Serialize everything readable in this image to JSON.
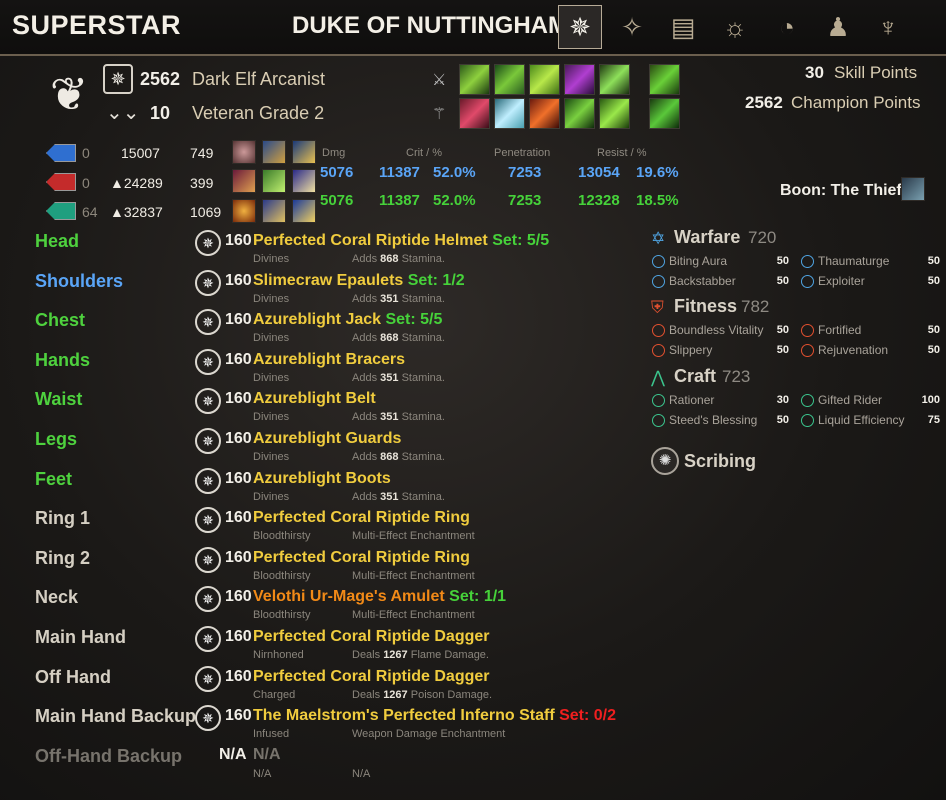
{
  "brand": "SUPERSTAR",
  "title": "DUKE OF NUTTINGHAM",
  "header": {
    "champion_level": "2562",
    "race_class": "Dark Elf Arcanist",
    "level": "10",
    "rank": "Veteran Grade 2",
    "skill_points": "30",
    "skill_points_label": "Skill Points",
    "champion_points": "2562",
    "champion_points_label": "Champion Points"
  },
  "resources": [
    {
      "color": "#2f6fd0",
      "regen": "0",
      "max": "15007",
      "recovery": "749"
    },
    {
      "color": "#c42b2b",
      "regen": "0",
      "max": "▲24289",
      "recovery": "399"
    },
    {
      "color": "#1f9f7f",
      "regen": "64",
      "max": "▲32837",
      "recovery": "1069"
    }
  ],
  "stat_headers": {
    "dmg": "Dmg",
    "crit": "Crit / %",
    "pen": "Penetration",
    "resist": "Resist / %"
  },
  "stats_blue": {
    "dmg": "5076",
    "crit": "11387",
    "crit_pct": "52.0%",
    "pen": "7253",
    "resist": "13054",
    "resist_pct": "19.6%"
  },
  "stats_green": {
    "dmg": "5076",
    "crit": "11387",
    "crit_pct": "52.0%",
    "pen": "7253",
    "resist": "12328",
    "resist_pct": "18.5%"
  },
  "boon": "Boon: The Thief",
  "gear": [
    {
      "slot": "Head",
      "slot_color": "green",
      "cp": "160",
      "name": "Perfected Coral Riptide Helmet",
      "set": "Set: 5/5",
      "set_color": "green",
      "trait": "Divines",
      "ench_pre": "Adds",
      "ench_val": "868",
      "ench_post": "Stamina."
    },
    {
      "slot": "Shoulders",
      "slot_color": "blue",
      "cp": "160",
      "name": "Slimecraw Epaulets",
      "set": "Set: 1/2",
      "set_color": "green",
      "trait": "Divines",
      "ench_pre": "Adds",
      "ench_val": "351",
      "ench_post": "Stamina."
    },
    {
      "slot": "Chest",
      "slot_color": "green",
      "cp": "160",
      "name": "Azureblight Jack",
      "set": "Set: 5/5",
      "set_color": "green",
      "trait": "Divines",
      "ench_pre": "Adds",
      "ench_val": "868",
      "ench_post": "Stamina."
    },
    {
      "slot": "Hands",
      "slot_color": "green",
      "cp": "160",
      "name": "Azureblight Bracers",
      "set": "",
      "set_color": "green",
      "trait": "Divines",
      "ench_pre": "Adds",
      "ench_val": "351",
      "ench_post": "Stamina."
    },
    {
      "slot": "Waist",
      "slot_color": "green",
      "cp": "160",
      "name": "Azureblight Belt",
      "set": "",
      "set_color": "green",
      "trait": "Divines",
      "ench_pre": "Adds",
      "ench_val": "351",
      "ench_post": "Stamina."
    },
    {
      "slot": "Legs",
      "slot_color": "green",
      "cp": "160",
      "name": "Azureblight Guards",
      "set": "",
      "set_color": "green",
      "trait": "Divines",
      "ench_pre": "Adds",
      "ench_val": "868",
      "ench_post": "Stamina."
    },
    {
      "slot": "Feet",
      "slot_color": "green",
      "cp": "160",
      "name": "Azureblight Boots",
      "set": "",
      "set_color": "green",
      "trait": "Divines",
      "ench_pre": "Adds",
      "ench_val": "351",
      "ench_post": "Stamina."
    },
    {
      "slot": "Ring 1",
      "slot_color": "white",
      "cp": "160",
      "name": "Perfected Coral Riptide Ring",
      "set": "",
      "set_color": "green",
      "trait": "Bloodthirsty",
      "ench_pre": "Multi-Effect Enchantment",
      "ench_val": "",
      "ench_post": ""
    },
    {
      "slot": "Ring 2",
      "slot_color": "white",
      "cp": "160",
      "name": "Perfected Coral Riptide Ring",
      "set": "",
      "set_color": "green",
      "trait": "Bloodthirsty",
      "ench_pre": "Multi-Effect Enchantment",
      "ench_val": "",
      "ench_post": ""
    },
    {
      "slot": "Neck",
      "slot_color": "white",
      "cp": "160",
      "name": "Velothi Ur-Mage's Amulet",
      "name_color": "orange",
      "set": "Set: 1/1",
      "set_color": "green",
      "trait": "Bloodthirsty",
      "ench_pre": "Multi-Effect Enchantment",
      "ench_val": "",
      "ench_post": ""
    },
    {
      "slot": "Main Hand",
      "slot_color": "white",
      "cp": "160",
      "name": "Perfected Coral Riptide Dagger",
      "set": "",
      "set_color": "green",
      "trait": "Nirnhoned",
      "ench_pre": "Deals",
      "ench_val": "1267",
      "ench_post": "Flame Damage."
    },
    {
      "slot": "Off Hand",
      "slot_color": "white",
      "cp": "160",
      "name": "Perfected Coral Riptide Dagger",
      "set": "",
      "set_color": "green",
      "trait": "Charged",
      "ench_pre": "Deals",
      "ench_val": "1267",
      "ench_post": "Poison Damage."
    },
    {
      "slot": "Main Hand Backup",
      "slot_color": "white",
      "cp": "160",
      "name": "The Maelstrom's Perfected Inferno Staff",
      "set": "Set: 0/2",
      "set_color": "red",
      "trait": "Infused",
      "ench_pre": "Weapon Damage Enchantment",
      "ench_val": "",
      "ench_post": ""
    }
  ],
  "offhand_backup": {
    "slot": "Off-Hand Backup",
    "na_bold": "N/A",
    "na_name": "N/A",
    "na_trait": "N/A",
    "na_ench": "N/A"
  },
  "cp": {
    "warfare": {
      "title": "Warfare",
      "value": "720",
      "color": "#4fa3e0",
      "stars": [
        {
          "name": "Biting Aura",
          "val": "50"
        },
        {
          "name": "Thaumaturge",
          "val": "50"
        },
        {
          "name": "Backstabber",
          "val": "50"
        },
        {
          "name": "Exploiter",
          "val": "50"
        }
      ]
    },
    "fitness": {
      "title": "Fitness",
      "value": "782",
      "color": "#e0502f",
      "stars": [
        {
          "name": "Boundless Vitality",
          "val": "50"
        },
        {
          "name": "Fortified",
          "val": "50"
        },
        {
          "name": "Slippery",
          "val": "50"
        },
        {
          "name": "Rejuvenation",
          "val": "50"
        }
      ]
    },
    "craft": {
      "title": "Craft",
      "value": "723",
      "color": "#3bc48d",
      "stars": [
        {
          "name": "Rationer",
          "val": "30"
        },
        {
          "name": "Gifted Rider",
          "val": "100"
        },
        {
          "name": "Steed's Blessing",
          "val": "50"
        },
        {
          "name": "Liquid Efficiency",
          "val": "75"
        }
      ]
    },
    "scribing": "Scribing"
  }
}
